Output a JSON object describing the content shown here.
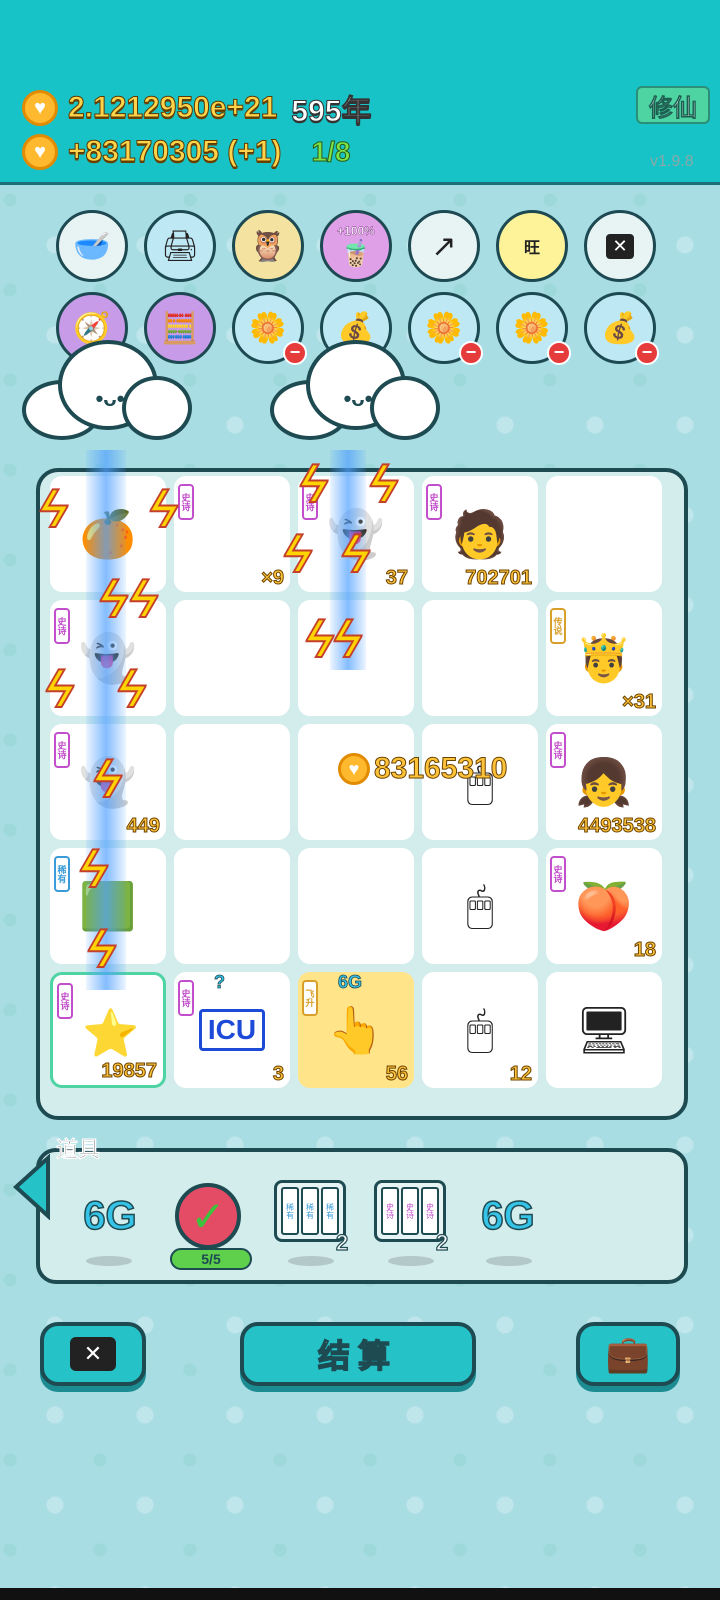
{
  "header": {
    "coins_total": "2.1212950e+21",
    "years": "595年",
    "coins_rate": "+83170305 (+1)",
    "progress": "1/8",
    "cultivate_button": "修仙",
    "version": "v1.9.8"
  },
  "buff_row1": [
    "bone-bowl-icon",
    "printer-icon",
    "owl-icon",
    "bubble-tea-icon",
    "growth-chart-icon",
    "wang-icon",
    "close-ad-icon"
  ],
  "buff_row1_labels": {
    "bubble_tea": "+100%",
    "wang": "旺"
  },
  "buff_row2": [
    "compass-icon",
    "math-person-icon",
    "flower-pot-icon",
    "sack-icon",
    "flower-pot-icon",
    "flower-pot-icon",
    "sack-icon"
  ],
  "board": {
    "floating_income": "83165310",
    "cells": [
      {
        "tag": "",
        "count": "",
        "icon": "orange-icon"
      },
      {
        "tag": "史诗",
        "count": "×9",
        "icon": ""
      },
      {
        "tag": "史诗",
        "count": "37",
        "icon": "ghost-icon"
      },
      {
        "tag": "史诗",
        "count": "702701",
        "icon": "green-hat-man-icon"
      },
      {
        "tag": "",
        "count": "",
        "icon": ""
      },
      {
        "tag": "史诗",
        "count": "",
        "icon": "ghost-icon"
      },
      {
        "tag": "",
        "count": "",
        "icon": ""
      },
      {
        "tag": "",
        "count": "",
        "icon": ""
      },
      {
        "tag": "",
        "count": "",
        "icon": ""
      },
      {
        "tag": "传说",
        "count": "×31",
        "icon": "king-icon"
      },
      {
        "tag": "史诗",
        "count": "449",
        "icon": "ghost-icon"
      },
      {
        "tag": "",
        "count": "",
        "icon": ""
      },
      {
        "tag": "",
        "count": "",
        "icon": ""
      },
      {
        "tag": "",
        "count": "",
        "icon": "mouse-icon"
      },
      {
        "tag": "史诗",
        "count": "4493538",
        "icon": "girl-icon"
      },
      {
        "tag": "稀有",
        "count": "",
        "icon": "bracket-icon"
      },
      {
        "tag": "",
        "count": "",
        "icon": ""
      },
      {
        "tag": "",
        "count": "",
        "icon": ""
      },
      {
        "tag": "",
        "count": "",
        "icon": "mouse-icon"
      },
      {
        "tag": "史诗",
        "count": "18",
        "icon": "peach-icon"
      },
      {
        "tag": "史诗",
        "count": "19857",
        "icon": "star-pile-icon"
      },
      {
        "tag": "史诗",
        "count": "3",
        "icon": "icu-icon",
        "label": "ICU",
        "extra": "?"
      },
      {
        "tag": "飞升",
        "count": "56",
        "icon": "hand-icon",
        "extra": "6G"
      },
      {
        "tag": "",
        "count": "12",
        "icon": "mouse-icon"
      },
      {
        "tag": "",
        "count": "",
        "icon": "computer-icon"
      }
    ]
  },
  "tools": {
    "label": "道具",
    "sixg_a": "6G",
    "check_count": "5/5",
    "scroll_a_count": "2",
    "scroll_b_count": "2",
    "sixg_b": "6G",
    "scroll_a_tag": "稀有",
    "scroll_b_tag": "史诗"
  },
  "bottom": {
    "settle_label": "结算"
  },
  "colors": {
    "header": "#17c3c6",
    "background": "#a9dde4",
    "gold": "#ffc33a",
    "epic": "#c24ecc",
    "rare": "#3a9bd8"
  }
}
